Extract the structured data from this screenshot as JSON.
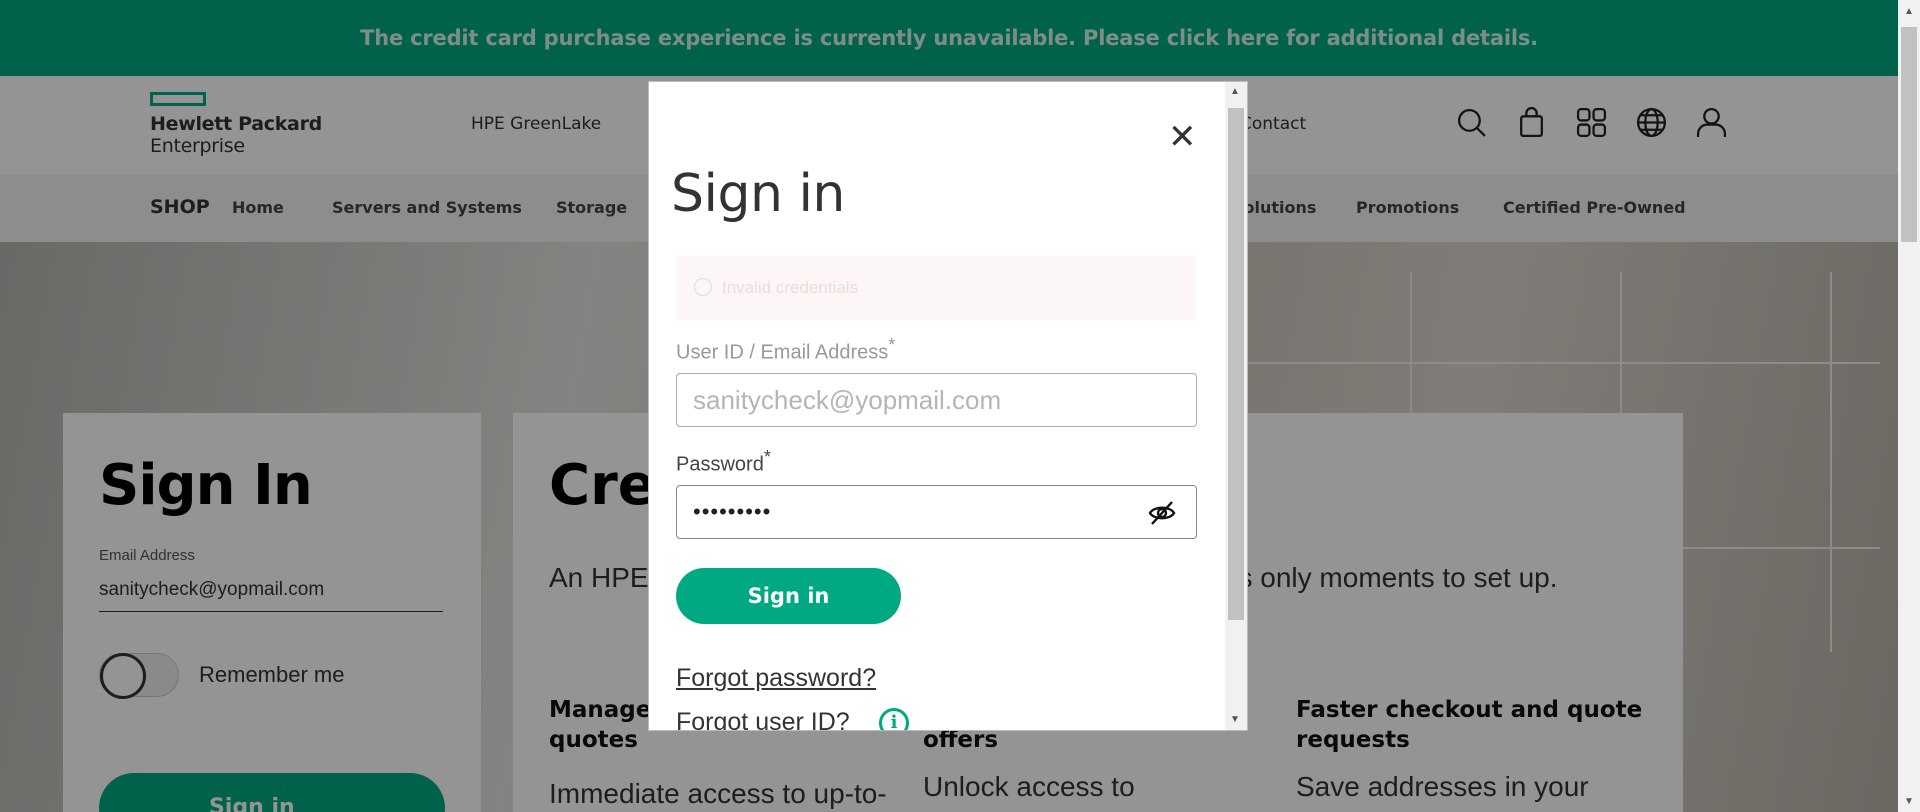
{
  "banner": {
    "text": "The credit card purchase experience is currently unavailable. Please click here for additional details."
  },
  "header": {
    "logo_line1": "Hewlett Packard",
    "logo_line2": "Enterprise",
    "links": [
      "HPE GreenLake",
      "Contact"
    ],
    "icons": [
      "search-icon",
      "cart-icon",
      "apps-grid-icon",
      "globe-icon",
      "user-icon"
    ]
  },
  "shopnav": {
    "shop_label": "SHOP",
    "items": [
      "Home",
      "Servers and Systems",
      "Storage",
      "Solutions",
      "Promotions",
      "Certified Pre-Owned"
    ]
  },
  "signin_card": {
    "title": "Sign In",
    "email_label": "Email Address",
    "email_value": "sanitycheck@yopmail.com",
    "remember_label": "Remember me",
    "button_label": "Sign in"
  },
  "create_card": {
    "title": "Cre",
    "description": "An HPE account gives you access to features, and takes only moments to set up.",
    "features": [
      {
        "title_l1": "Manage",
        "title_l2": "quotes",
        "desc": "Immediate access to up-to-"
      },
      {
        "title_l1": "",
        "title_l2": "offers",
        "desc": "Unlock access to"
      },
      {
        "title_l1": "Faster checkout and quote",
        "title_l2": "requests",
        "desc": "Save addresses in your"
      }
    ]
  },
  "modal": {
    "title": "Sign in",
    "alert_text": "Invalid credentials",
    "email_label": "User ID / Email Address",
    "email_value": "sanitycheck@yopmail.com",
    "password_label": "Password",
    "password_value": "•••••••••",
    "required_mark": "*",
    "button_label": "Sign in",
    "forgot_password": "Forgot password?",
    "forgot_userid": "Forgot user ID?",
    "close_glyph": "✕"
  },
  "colors": {
    "brand": "#01a982",
    "overlay": "rgba(0,0,0,0.42)"
  }
}
